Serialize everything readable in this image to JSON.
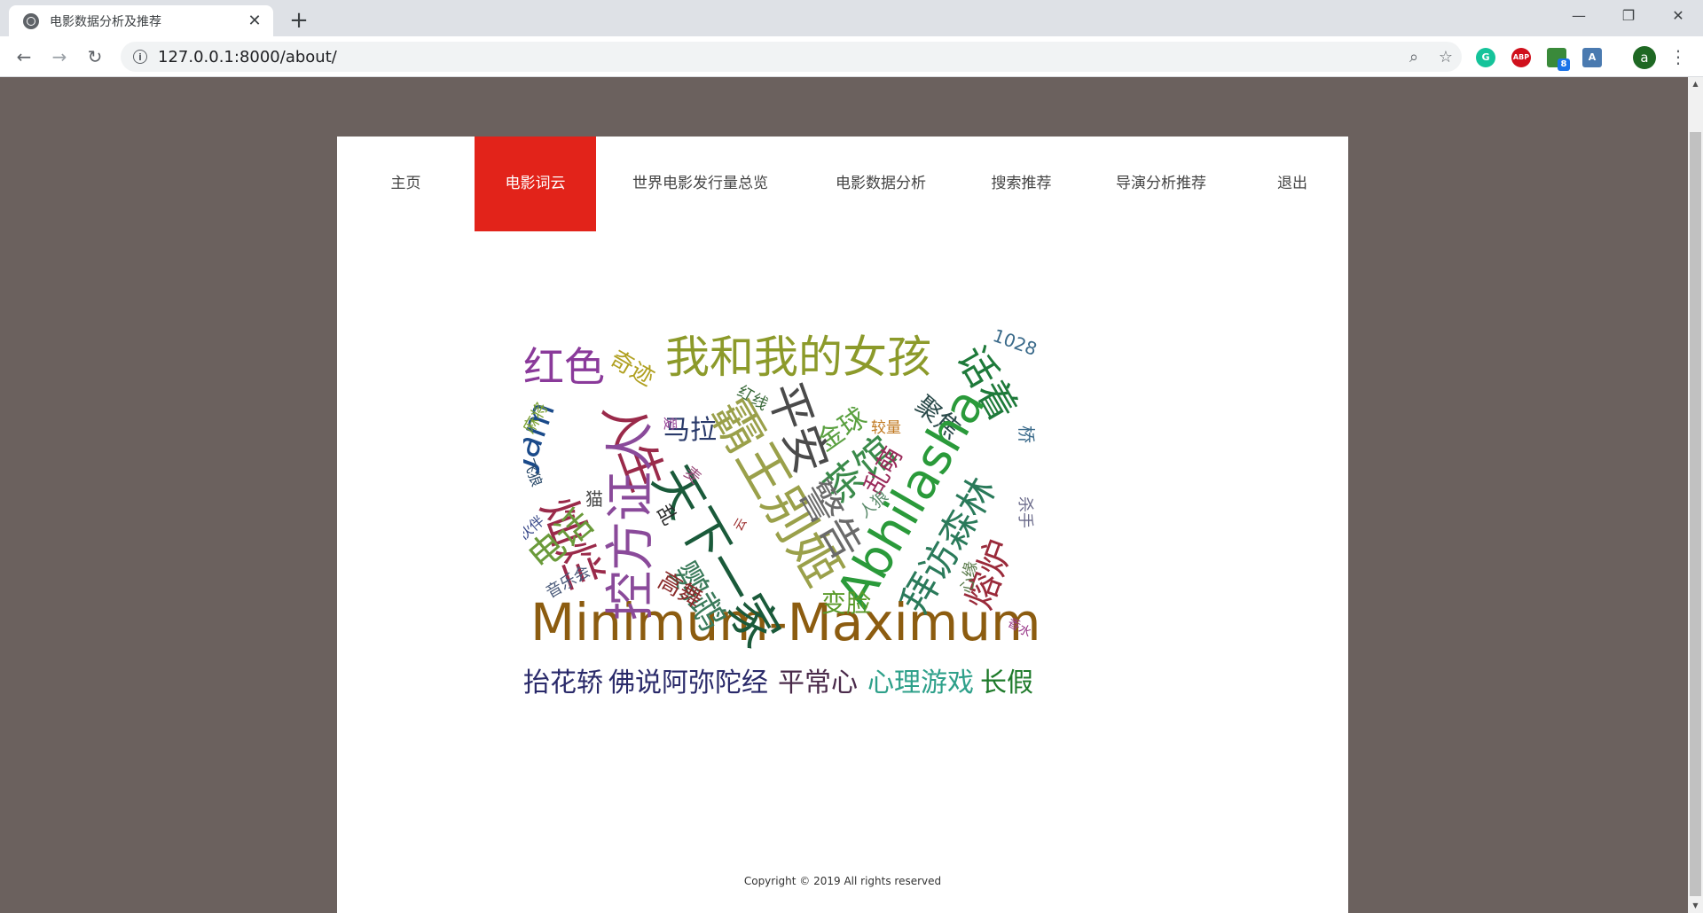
{
  "browser": {
    "tab_title": "电影数据分析及推荐",
    "url": "127.0.0.1:8000/about/",
    "profile_initial": "a",
    "ext_badge": "8"
  },
  "nav": {
    "items": [
      "主页",
      "电影词云",
      "世界电影发行量总览",
      "电影数据分析",
      "搜索推荐",
      "导演分析推荐",
      "退出"
    ],
    "active_index": 1,
    "accent": "#e2231a"
  },
  "cloud_words": [
    {
      "text": "Minimum-Maximum",
      "color": "#8c5c10"
    },
    {
      "text": "我和我的女孩",
      "color": "#8c9a2a"
    },
    {
      "text": "抬花轿",
      "color": "#2a2a6a"
    },
    {
      "text": "佛说阿弥陀经",
      "color": "#2a2a6a"
    },
    {
      "text": "平常心",
      "color": "#4a2a4a"
    },
    {
      "text": "心理游戏",
      "color": "#2ea08a"
    },
    {
      "text": "长假",
      "color": "#1e7a2a"
    },
    {
      "text": "红色",
      "color": "#8a3a9a"
    },
    {
      "text": "奇迹",
      "color": "#b0a020"
    },
    {
      "text": "话着",
      "color": "#1e7a3a"
    },
    {
      "text": "1028",
      "color": "#3a6a8a"
    },
    {
      "text": "马拉",
      "color": "#2a3a6a"
    },
    {
      "text": "较量",
      "color": "#c07820"
    },
    {
      "text": "聚焦",
      "color": "#2a4a4a"
    },
    {
      "text": "Jam",
      "color": "#1a4a8a"
    },
    {
      "text": "麻将",
      "color": "#7aa030"
    },
    {
      "text": "人生",
      "color": "#9a2a4a"
    },
    {
      "text": "灿烂",
      "color": "#9a2a4a"
    },
    {
      "text": "红线",
      "color": "#3a6a3a"
    },
    {
      "text": "金球",
      "color": "#5aa040"
    },
    {
      "text": "平安",
      "color": "#4a4a4a"
    },
    {
      "text": "天下一家",
      "color": "#1a5a3a"
    },
    {
      "text": "霸王别姬",
      "color": "#9aa04a"
    },
    {
      "text": "茶馆",
      "color": "#3a8a4a"
    },
    {
      "text": "Abhilasha",
      "color": "#2a9a3a"
    },
    {
      "text": "桥",
      "color": "#3a6a8a"
    },
    {
      "text": "拜访森林",
      "color": "#2a7a5a"
    },
    {
      "text": "控方证人",
      "color": "#8a4a9a"
    },
    {
      "text": "警告",
      "color": "#6a6a6a"
    },
    {
      "text": "乱",
      "color": "#2a2a2a"
    },
    {
      "text": "爱",
      "color": "#9a4a9a"
    },
    {
      "text": "乱萌",
      "color": "#9a2a5a"
    },
    {
      "text": "飞狼",
      "color": "#2a4a6a"
    },
    {
      "text": "猫",
      "color": "#4a4a4a"
    },
    {
      "text": "麦",
      "color": "#9a4a7a"
    },
    {
      "text": "人狼",
      "color": "#5a8a6a"
    },
    {
      "text": "杀手",
      "color": "#6a6a8a"
    },
    {
      "text": "电话",
      "color": "#6a9a3a"
    },
    {
      "text": "伙伴",
      "color": "#3a4a8a"
    },
    {
      "text": "鹦鹉",
      "color": "#3a7a5a"
    },
    {
      "text": "云",
      "color": "#9a2a2a"
    },
    {
      "text": "熔炉",
      "color": "#9a2a3a"
    },
    {
      "text": "心缘",
      "color": "#5a7a4a"
    },
    {
      "text": "音乐会",
      "color": "#4a5a7a"
    },
    {
      "text": "高舞",
      "color": "#8a2a2a"
    },
    {
      "text": "变脸",
      "color": "#5a9a2a"
    },
    {
      "text": "香水",
      "color": "#9a3a8a"
    }
  ],
  "footer": "Copyright © 2019 All rights reserved"
}
